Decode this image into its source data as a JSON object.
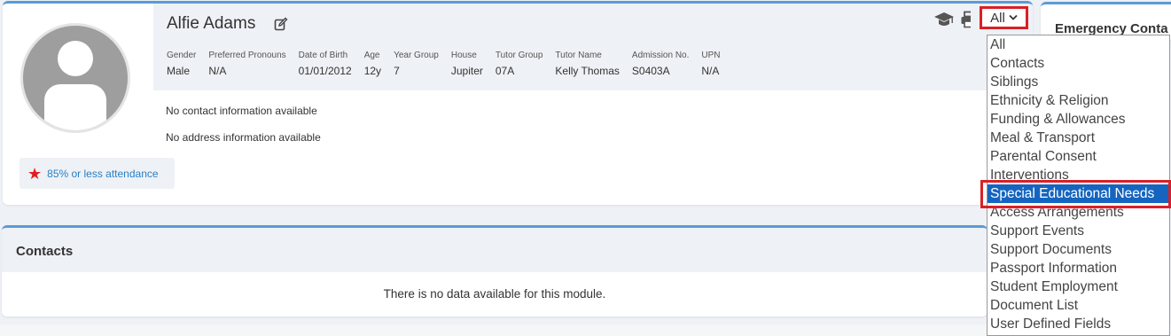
{
  "student": {
    "name": "Alfie Adams",
    "fields": [
      {
        "label": "Gender",
        "value": "Male"
      },
      {
        "label": "Preferred Pronouns",
        "value": "N/A"
      },
      {
        "label": "Date of Birth",
        "value": "01/01/2012"
      },
      {
        "label": "Age",
        "value": "12y"
      },
      {
        "label": "Year Group",
        "value": "7"
      },
      {
        "label": "House",
        "value": "Jupiter"
      },
      {
        "label": "Tutor Group",
        "value": "07A"
      },
      {
        "label": "Tutor Name",
        "value": "Kelly Thomas"
      },
      {
        "label": "Admission No.",
        "value": "S0403A"
      },
      {
        "label": "UPN",
        "value": "N/A"
      }
    ],
    "contact_info": "No contact information available",
    "address_info": "No address information available",
    "attendance_flag": "85% or less attendance"
  },
  "filter": {
    "selected": "All",
    "options": [
      "All",
      "Contacts",
      "Siblings",
      "Ethnicity & Religion",
      "Funding & Allowances",
      "Meal & Transport",
      "Parental Consent",
      "Interventions",
      "Special Educational Needs",
      "Access Arrangements",
      "Support Events",
      "Support Documents",
      "Passport Information",
      "Student Employment",
      "Document List",
      "User Defined Fields"
    ],
    "highlighted_index": 8
  },
  "emergency": {
    "title": "Emergency Conta"
  },
  "contacts": {
    "title": "Contacts",
    "empty_message": "There is no data available for this module."
  },
  "colors": {
    "accent": "#5b9bd5",
    "highlight_outline": "#d92027",
    "selected_option": "#1565c0",
    "link": "#2a7fc4",
    "star": "#e02020"
  },
  "icons": [
    "edit-icon",
    "graduation-cap-icon",
    "print-icon",
    "star-icon",
    "chevron-down-icon"
  ]
}
